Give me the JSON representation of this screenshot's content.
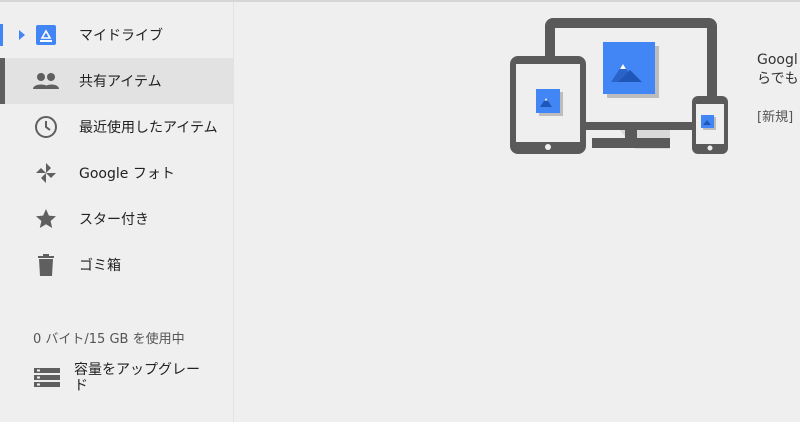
{
  "sidebar": {
    "items": [
      {
        "label": "マイドライブ",
        "icon": "drive-folder-icon",
        "expandable": true
      },
      {
        "label": "共有アイテム",
        "icon": "people-icon",
        "active": true
      },
      {
        "label": "最近使用したアイテム",
        "icon": "clock-icon"
      },
      {
        "label": "Google フォト",
        "icon": "photos-pinwheel-icon"
      },
      {
        "label": "スター付き",
        "icon": "star-icon"
      },
      {
        "label": "ゴミ箱",
        "icon": "trash-icon"
      }
    ],
    "storage": "0 バイト/15 GB を使用中",
    "upgrade_label": "容量をアップグレード"
  },
  "main": {
    "promo_line1": "Googl",
    "promo_line2": "らでも",
    "promo_new": "[新規] "
  },
  "colors": {
    "accent": "#4285f4",
    "sidebar_bg": "#efefef",
    "active_bg": "#e2e2e2",
    "icon_gray": "#5f5f5f"
  }
}
